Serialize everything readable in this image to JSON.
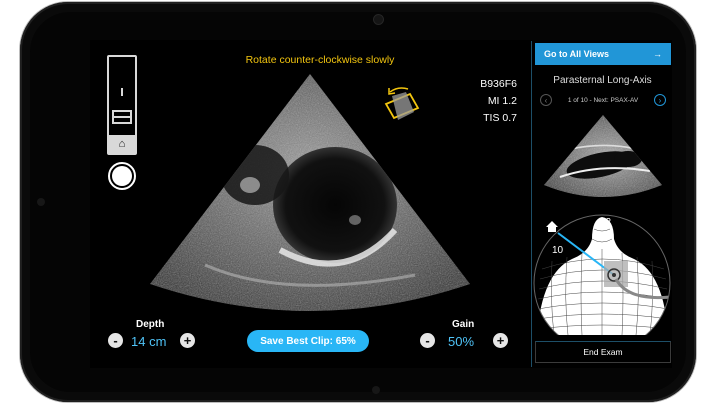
{
  "instruction": "Rotate counter-clockwise slowly",
  "readouts": {
    "probe_id": "B936F6",
    "mi": "MI 1.2",
    "tis": "TIS 0.7"
  },
  "depth": {
    "label": "Depth",
    "value": "14 cm",
    "minus": "-",
    "plus": "+"
  },
  "gain": {
    "label": "Gain",
    "value": "50%",
    "minus": "-",
    "plus": "+"
  },
  "save_button": "Save Best Clip: 65%",
  "panel": {
    "go_all_views": "Go to All Views",
    "arrow": "→",
    "view_title": "Parasternal Long-Axis",
    "view_count": "1 of 10 - Next: PSAX-AV",
    "prev": "‹",
    "next": "›",
    "clock_12": "12",
    "clock_10": "10",
    "end_exam": "End Exam"
  },
  "icons": {
    "home": "home-icon",
    "rotate": "rotate-ccw-icon"
  },
  "colors": {
    "accent": "#29b6f6",
    "instruction": "#f2c50f",
    "probe": "#f2c50f"
  }
}
